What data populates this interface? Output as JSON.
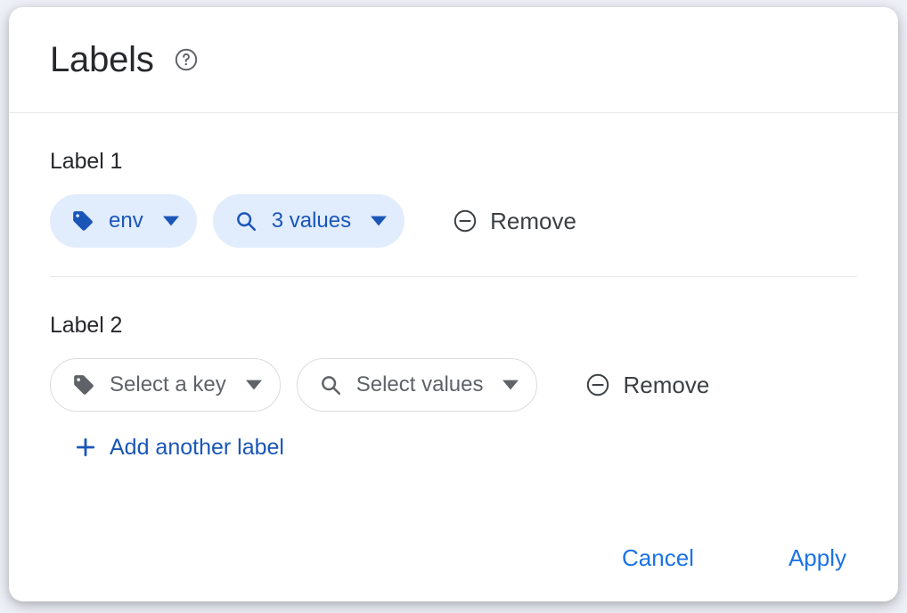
{
  "dialog": {
    "title": "Labels",
    "help_icon": "help-circle-icon"
  },
  "label_groups": [
    {
      "title": "Label 1",
      "state": "filled",
      "key_chip": {
        "icon": "tag-icon",
        "text": "env",
        "caret": "chevron-down-icon"
      },
      "values_chip": {
        "icon": "search-icon",
        "text": "3 values",
        "caret": "chevron-down-icon"
      },
      "remove": {
        "icon": "remove-circle-icon",
        "label": "Remove"
      }
    },
    {
      "title": "Label 2",
      "state": "outlined",
      "key_chip": {
        "icon": "tag-icon",
        "text": "Select a key",
        "caret": "chevron-down-icon"
      },
      "values_chip": {
        "icon": "search-icon",
        "text": "Select values",
        "caret": "chevron-down-icon"
      },
      "remove": {
        "icon": "remove-circle-icon",
        "label": "Remove"
      }
    }
  ],
  "add_another": {
    "icon": "plus-icon",
    "label": "Add another label"
  },
  "footer": {
    "cancel_label": "Cancel",
    "apply_label": "Apply"
  },
  "colors": {
    "accent_blue": "#1a73e8",
    "chip_blue_text": "#1a56b8",
    "chip_blue_bg": "#e1ecfd",
    "chip_border": "#dadce0",
    "muted_text": "#5f6368",
    "divider": "#e6e7e9",
    "page_bg": "#eef1f7"
  }
}
